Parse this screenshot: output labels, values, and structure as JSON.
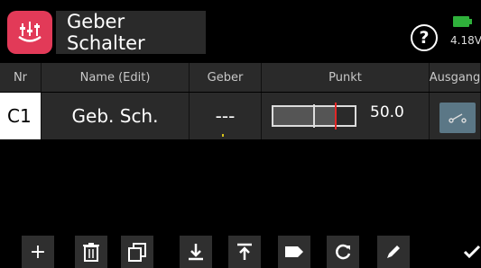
{
  "header": {
    "title": "Geber Schalter",
    "battery": "4.18V"
  },
  "table": {
    "columns": [
      "Nr",
      "Name (Edit)",
      "Geber",
      "Punkt",
      "Ausgang"
    ],
    "rows": [
      {
        "nr": "C1",
        "name": "Geb. Sch.",
        "geber": "---",
        "punkt_value": "50.0",
        "slider_level_percent": 75
      }
    ]
  },
  "toolbar": [
    "plus-icon",
    "trash-icon",
    "copy-icon",
    "download-icon",
    "upload-icon",
    "tag-icon",
    "reload-icon",
    "edit-icon",
    "check-icon"
  ],
  "colors": {
    "accent": "#e23a58",
    "battery": "#2fb13b",
    "marker": "#e32727",
    "output_button": "#5b7786"
  }
}
